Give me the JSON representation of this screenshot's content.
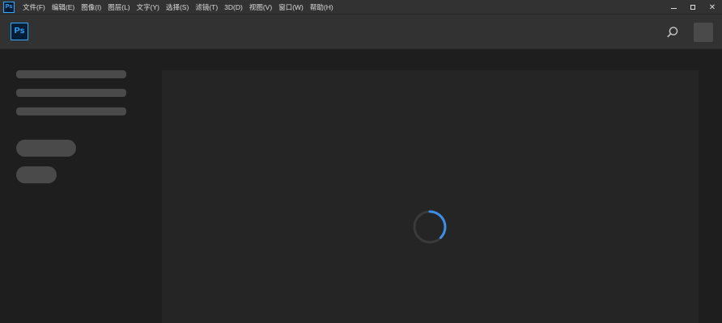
{
  "menubar": {
    "app_icon_text": "Ps",
    "items": [
      "文件(F)",
      "编辑(E)",
      "图像(I)",
      "图层(L)",
      "文字(Y)",
      "选择(S)",
      "滤镜(T)",
      "3D(D)",
      "视图(V)",
      "窗口(W)",
      "帮助(H)"
    ],
    "close_glyph": "✕"
  },
  "header": {
    "logo_text": "Ps",
    "search_icon": "search-icon"
  },
  "colors": {
    "brand": "#31a8ff",
    "background": "#1e1e1e",
    "panel": "#252525",
    "skeleton": "#4a4a4a",
    "spinner_active": "#3d8ee8"
  },
  "loading": {
    "state": "loading"
  }
}
